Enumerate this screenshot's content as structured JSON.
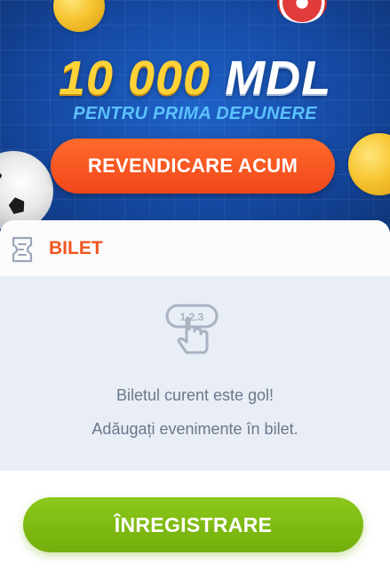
{
  "promo": {
    "amount": "10 000",
    "currency": "MDL",
    "subtitle": "PENTRU PRIMA DEPUNERE",
    "cta_label": "REVENDICARE ACUM",
    "decorations": [
      "gold-coin-icon",
      "casino-chip-icon",
      "soccer-ball-icon"
    ]
  },
  "ticket": {
    "icon": "ticket-icon",
    "title": "BILET",
    "empty_icon": "tap-numbers-icon",
    "empty_icon_digits": "1.2.3",
    "empty_line1": "Biletul curent este gol!",
    "empty_line2": "Adăugați evenimente în bilet."
  },
  "footer": {
    "register_label": "ÎNREGISTRARE"
  },
  "colors": {
    "accent_orange": "#f0561f",
    "register_green": "#7fbc12",
    "banner_blue": "#1549a3",
    "empty_bg": "#e9edf5",
    "muted_text": "#6b788c"
  }
}
